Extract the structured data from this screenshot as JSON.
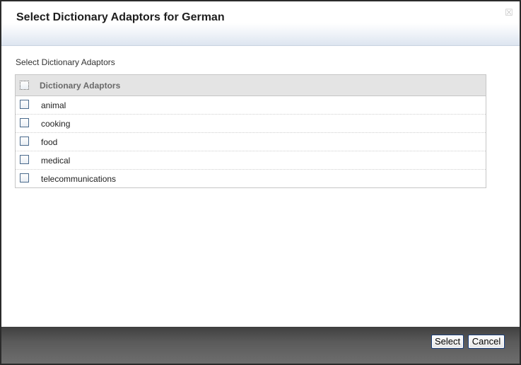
{
  "dialog": {
    "title": "Select Dictionary Adaptors for German",
    "close_icon": "close-icon"
  },
  "section": {
    "label": "Select Dictionary Adaptors"
  },
  "grid": {
    "header_label": "Dictionary Adaptors",
    "rows": [
      {
        "label": "animal",
        "checked": false
      },
      {
        "label": "cooking",
        "checked": false
      },
      {
        "label": "food",
        "checked": false
      },
      {
        "label": "medical",
        "checked": false
      },
      {
        "label": "telecommunications",
        "checked": false
      }
    ]
  },
  "footer": {
    "select_label": "Select",
    "cancel_label": "Cancel"
  }
}
